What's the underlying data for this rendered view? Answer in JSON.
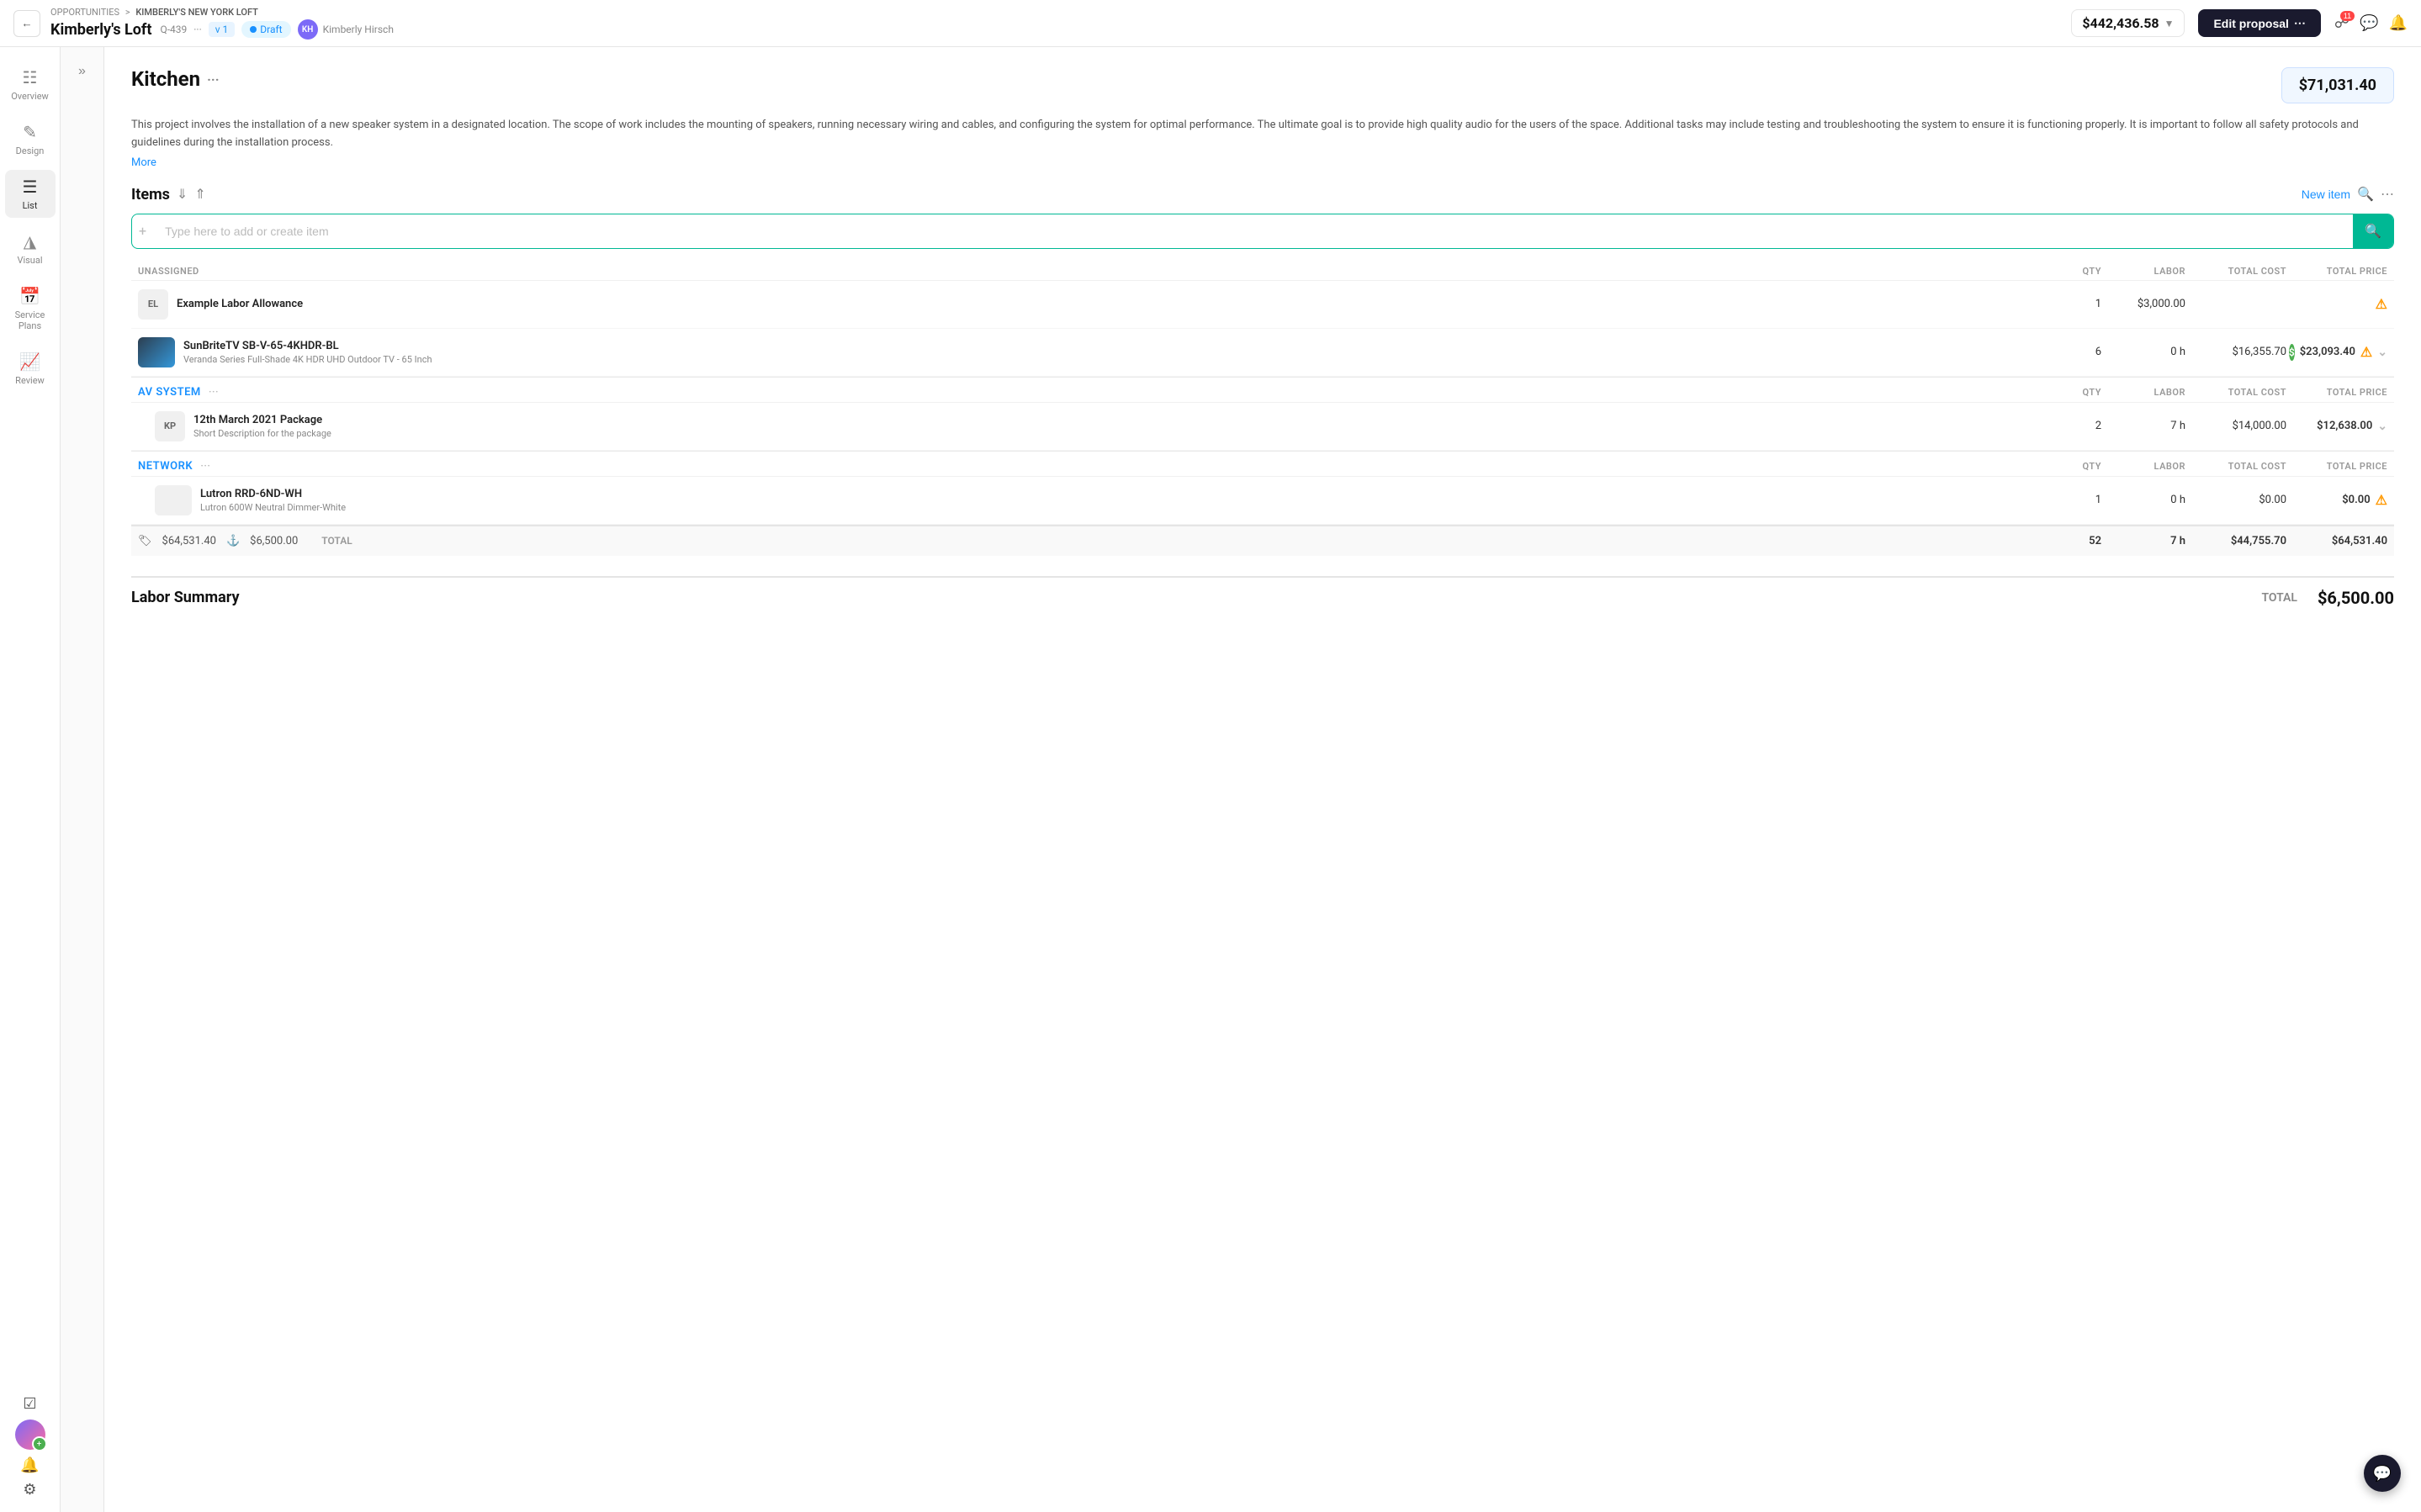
{
  "meta": {
    "breadcrumb_part1": "OPPORTUNITIES",
    "breadcrumb_sep": ">",
    "breadcrumb_part2": "KIMBERLY'S NEW YORK LOFT",
    "project_name": "Kimberly's Loft",
    "quote_num": "Q-439",
    "version": "v 1",
    "status": "Draft",
    "assignee_initials": "KH",
    "assignee_name": "Kimberly Hirsch",
    "total_price": "$442,436.58"
  },
  "toolbar": {
    "edit_proposal_label": "Edit proposal",
    "notification_count": "11"
  },
  "sidebar": {
    "overview_label": "Overview",
    "design_label": "Design",
    "list_label": "List",
    "visual_label": "Visual",
    "service_plans_label": "Service Plans",
    "review_label": "Review"
  },
  "page": {
    "title": "Kitchen",
    "title_dots": "···",
    "price": "$71,031.40",
    "description": "This project involves the installation of a new speaker system in a designated location. The scope of work includes the mounting of speakers, running necessary wiring and cables, and configuring the system for optimal performance. The ultimate goal is to provide high quality audio for the users of the space. Additional tasks may include testing and troubleshooting the system to ensure it is functioning properly. It is important to follow all safety protocols and guidelines during the installation process.",
    "more_label": "More",
    "items_label": "Items",
    "new_item_label": "New item",
    "add_placeholder": "Type here to add or create item"
  },
  "columns": {
    "qty": "QTY",
    "labor": "LABOR",
    "total_cost": "TOTAL COST",
    "total_price": "TOTAL PRICE"
  },
  "unassigned": {
    "label": "Unassigned",
    "items": [
      {
        "badge": "EL",
        "name": "Example Labor Allowance",
        "desc": "",
        "qty": "1",
        "labor": "$3,000.00",
        "total_cost": "",
        "total_price": "",
        "has_warning": true,
        "has_green": false,
        "has_expand": false
      },
      {
        "badge": "IMG",
        "name": "SunBriteTV SB-V-65-4KHDR-BL",
        "desc": "Veranda Series Full-Shade 4K HDR UHD Outdoor TV - 65 Inch",
        "qty": "6",
        "labor": "0 h",
        "total_cost": "$16,355.70",
        "total_price": "$23,093.40",
        "has_warning": true,
        "has_green": true,
        "has_expand": true
      }
    ]
  },
  "av_system": {
    "label": "AV System",
    "items": [
      {
        "badge": "KP",
        "name": "12th March 2021 Package",
        "desc": "Short Description for the package",
        "qty": "2",
        "labor": "7 h",
        "total_cost": "$14,000.00",
        "total_price": "$12,638.00",
        "has_warning": false,
        "has_green": false,
        "has_expand": true
      }
    ]
  },
  "network": {
    "label": "Network",
    "items": [
      {
        "badge": "IMG2",
        "name": "Lutron RRD-6ND-WH",
        "desc": "Lutron 600W Neutral Dimmer-White",
        "qty": "1",
        "labor": "0 h",
        "total_cost": "$0.00",
        "total_price": "$0.00",
        "has_warning": true,
        "has_green": false,
        "has_expand": false
      }
    ]
  },
  "totals": {
    "cost_total": "$64,531.40",
    "labor_total": "$6,500.00",
    "label": "TOTAL",
    "qty": "52",
    "labor_hours": "7 h",
    "total_cost": "$44,755.70",
    "total_price": "$64,531.40"
  },
  "labor_summary": {
    "title": "Labor Summary",
    "total_label": "Total",
    "total_value": "$6,500.00"
  }
}
